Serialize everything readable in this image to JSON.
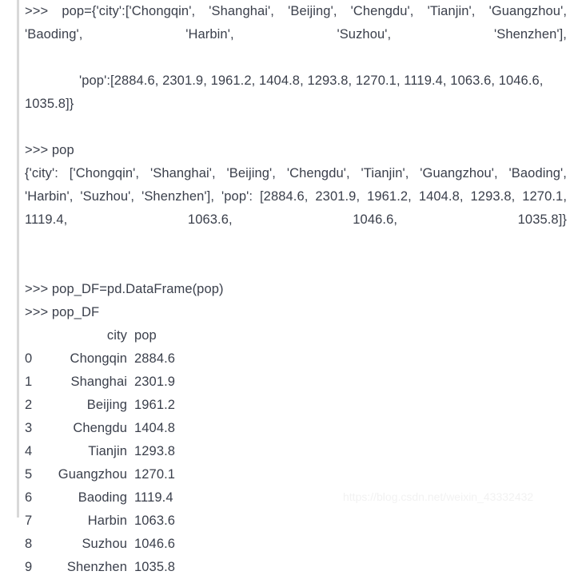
{
  "console": {
    "prompt": ">>>",
    "assign_statement": ">>>  pop={'city':['Chongqin', 'Shanghai', 'Beijing', 'Chengdu', 'Tianjin', 'Guangzhou', 'Baoding', 'Harbin', 'Suzhou', 'Shenzhen'],",
    "assign_statement_line1": ">>>  pop={'city':['Chongqin', 'Shanghai', 'Beijing', 'Chengdu', 'Tianjin', 'Guangzhou', 'Baoding', 'Harbin', 'Suzhou', 'Shenzhen'],",
    "assign_statement_line2": "'pop':[2884.6, 2301.9, 1961.2, 1404.8, 1293.8, 1270.1, 1119.4, 1063.6, 1046.6, 1035.8]}",
    "echo_command": ">>> pop",
    "echo_output": "{'city': ['Chongqin', 'Shanghai', 'Beijing', 'Chengdu', 'Tianjin', 'Guangzhou', 'Baoding', 'Harbin', 'Suzhou', 'Shenzhen'], 'pop': [2884.6, 2301.9, 1961.2, 1404.8, 1293.8, 1270.1, 1119.4, 1063.6, 1046.6, 1035.8]}",
    "dataframe_command": ">>> pop_DF=pd.DataFrame(pop)",
    "show_command": ">>> pop_DF"
  },
  "dataframe": {
    "columns": [
      "",
      "city",
      "pop"
    ],
    "rows": [
      {
        "index": "0",
        "city": "Chongqin",
        "pop": "2884.6"
      },
      {
        "index": "1",
        "city": "Shanghai",
        "pop": "2301.9"
      },
      {
        "index": "2",
        "city": "Beijing",
        "pop": "1961.2"
      },
      {
        "index": "3",
        "city": "Chengdu",
        "pop": "1404.8"
      },
      {
        "index": "4",
        "city": "Tianjin",
        "pop": "1293.8"
      },
      {
        "index": "5",
        "city": "Guangzhou",
        "pop": "1270.1"
      },
      {
        "index": "6",
        "city": "Baoding",
        "pop": "1119.4"
      },
      {
        "index": "7",
        "city": "Harbin",
        "pop": "1063.6"
      },
      {
        "index": "8",
        "city": "Suzhou",
        "pop": "1046.6"
      },
      {
        "index": "9",
        "city": "Shenzhen",
        "pop": "1035.8"
      }
    ]
  },
  "watermark": {
    "text": "https://blog.csdn.net/weixin_43332432"
  },
  "colors": {
    "text": "#3a3f4b",
    "gutter_rule": "#d8d8d8",
    "background": "#ffffff",
    "watermark": "#f2f2f2"
  }
}
